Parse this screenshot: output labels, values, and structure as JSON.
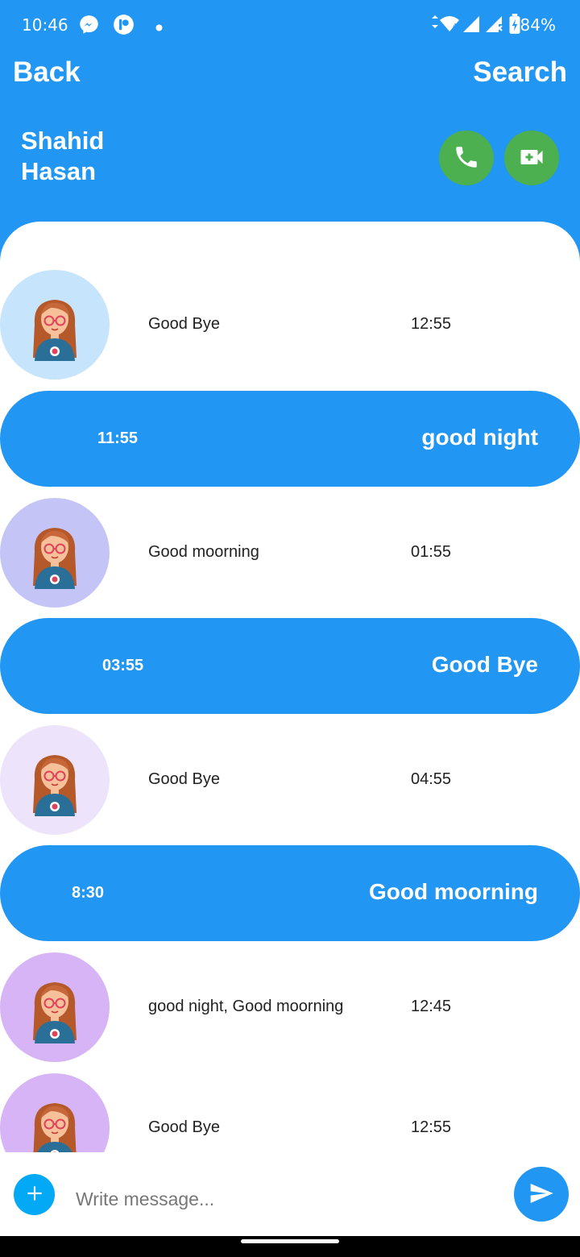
{
  "status_bar": {
    "time": "10:46",
    "icons": [
      "messenger-icon",
      "app-notification-icon",
      "dot-icon",
      "wifi-icon",
      "signal-icon",
      "signal-no-icon",
      "battery-icon"
    ],
    "battery": "84%"
  },
  "appbar": {
    "back_label": "Back",
    "search_label": "Search"
  },
  "contact": {
    "name": "Shahid Hasan"
  },
  "colors": {
    "primary": "#2196f3",
    "call_green": "#4caf50",
    "add_blue": "#03a9f4"
  },
  "messages": [
    {
      "direction": "incoming",
      "text": "Good Bye",
      "time": "12:55",
      "avatar_bg": "#c6e4fb"
    },
    {
      "direction": "outgoing",
      "text": "good night",
      "time": "11:55"
    },
    {
      "direction": "incoming",
      "text": "Good moorning",
      "time": "01:55",
      "avatar_bg": "#c4c4f7"
    },
    {
      "direction": "outgoing",
      "text": "Good Bye",
      "time": "03:55"
    },
    {
      "direction": "incoming",
      "text": "Good Bye",
      "time": "04:55",
      "avatar_bg": "#ede4fb"
    },
    {
      "direction": "outgoing",
      "text": "Good moorning",
      "time": "8:30"
    },
    {
      "direction": "incoming",
      "text": "good night, Good moorning",
      "time": "12:45",
      "avatar_bg": "#d6b4f6"
    },
    {
      "direction": "incoming",
      "text": "Good Bye",
      "time": "12:55",
      "avatar_bg": "#d6b4f6"
    }
  ],
  "composer": {
    "placeholder": "Write message..."
  }
}
